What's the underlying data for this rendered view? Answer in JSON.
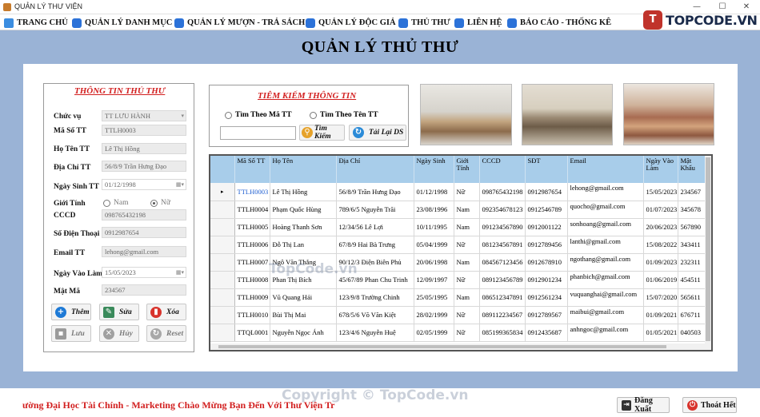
{
  "window": {
    "title": "QUẢN LÝ THƯ VIỆN",
    "minimize": "—",
    "maximize": "☐",
    "close": "✕"
  },
  "menu": [
    {
      "label": "TRANG CHỦ",
      "icon": "home-icon"
    },
    {
      "label": "QUẢN LÝ DANH MỤC",
      "icon": "folder-icon"
    },
    {
      "label": "QUẢN LÝ MƯỢN - TRẢ SÁCH",
      "icon": "book-icon"
    },
    {
      "label": "QUẢN LÝ ĐỘC GIẢ",
      "icon": "reader-icon"
    },
    {
      "label": "THỦ THƯ",
      "icon": "librarian-icon"
    },
    {
      "label": "LIÊN HỆ",
      "icon": "contact-icon"
    },
    {
      "label": "BÁO CÁO - THỐNG KÊ",
      "icon": "report-icon"
    }
  ],
  "logo": {
    "mark": "T",
    "text": "TOPCODE.VN"
  },
  "page_title": "QUẢN LÝ THỦ THƯ",
  "info_panel": {
    "title": "THÔNG TIN THỦ THƯ",
    "chuc_vu": {
      "label": "Chức vụ",
      "value": "TT LƯU HÀNH"
    },
    "ma_so": {
      "label": "Mã Số TT",
      "value": "TTLH0003"
    },
    "ho_ten": {
      "label": "Họ Tên TT",
      "value": "Lê Thị Hồng"
    },
    "dia_chi": {
      "label": "Địa Chỉ TT",
      "value": "56/8/9 Trần Hưng Đạo"
    },
    "ngay_sinh": {
      "label": "Ngày Sinh TT",
      "value": "01/12/1998"
    },
    "gioi_tinh": {
      "label": "Giới Tính",
      "options": [
        "Nam",
        "Nữ"
      ],
      "selected": "Nữ"
    },
    "cccd": {
      "label": "CCCD",
      "value": "098765432198"
    },
    "so_dien_thoai": {
      "label": "Số Điện Thoại",
      "value": "0912987654"
    },
    "email": {
      "label": "Email TT",
      "value": "lehong@gmail.com"
    },
    "ngay_vao_lam": {
      "label": "Ngày Vào Làm",
      "value": "15/05/2023"
    },
    "mat_ma": {
      "label": "Mật Mã",
      "value": "234567"
    },
    "buttons": {
      "them": "Thêm",
      "sua": "Sửa",
      "xoa": "Xóa",
      "luu": "Lưu",
      "huy": "Hủy",
      "reset": "Reset"
    }
  },
  "search_panel": {
    "title": "TIÊM KIẾM THÔNG TIN",
    "option_ma": "Tìm Theo Mã TT",
    "option_ten": "Tìm Theo Tên TT",
    "input_value": "",
    "search_button": "Tìm Kiếm",
    "reload_button": "Tải Lại DS"
  },
  "table": {
    "headers": [
      "Mã Số TT",
      "Họ Tên",
      "Địa Chỉ",
      "Ngày Sinh",
      "Giới Tính",
      "CCCD",
      "SĐT",
      "Email",
      "Ngày Vào Làm",
      "Mật Khẩu"
    ],
    "rows": [
      [
        "TTLH0003",
        "Lê Thị Hồng",
        "56/8/9 Trần Hưng Đạo",
        "01/12/1998",
        "Nữ",
        "098765432198",
        "0912987654",
        "lehong@gmail.com",
        "15/05/2023",
        "234567"
      ],
      [
        "TTLH0004",
        "Phạm Quốc Hùng",
        "789/6/5 Nguyễn Trãi",
        "23/08/1996",
        "Nam",
        "092354678123",
        "0912546789",
        "quocho@gmail.com",
        "01/07/2023",
        "345678"
      ],
      [
        "TTLH0005",
        "Hoàng Thanh Sơn",
        "12/34/56 Lê Lợi",
        "10/11/1995",
        "Nam",
        "091234567890",
        "0912001122",
        "sonhoang@gmail.com",
        "20/06/2023",
        "567890"
      ],
      [
        "TTLH0006",
        "Đỗ Thị Lan",
        "67/8/9 Hai Bà Trưng",
        "05/04/1999",
        "Nữ",
        "081234567891",
        "0912789456",
        "lanthi@gmail.com",
        "15/08/2022",
        "343411"
      ],
      [
        "TTLH0007",
        "Ngô Văn Thắng",
        "90/12/3 Điện Biên Phủ",
        "20/06/1998",
        "Nam",
        "084567123456",
        "0912678910",
        "ngothang@gmail.com",
        "01/09/2023",
        "232311"
      ],
      [
        "TTLH0008",
        "Phan Thị Bích",
        "45/67/89 Phan Chu Trinh",
        "12/09/1997",
        "Nữ",
        "089123456789",
        "0912901234",
        "phanbich@gmail.com",
        "01/06/2019",
        "454511"
      ],
      [
        "TTLH0009",
        "Vũ Quang Hải",
        "123/9/8 Trường Chinh",
        "25/05/1995",
        "Nam",
        "086512347891",
        "0912561234",
        "vuquanghai@gmail.com",
        "15/07/2020",
        "565611"
      ],
      [
        "TTLH0010",
        "Bùi Thị Mai",
        "678/5/6 Võ Văn Kiệt",
        "28/02/1999",
        "Nữ",
        "089112234567",
        "0912789567",
        "maibui@gmail.com",
        "01/09/2021",
        "676711"
      ],
      [
        "TTQL0001",
        "Nguyễn Ngọc Ánh",
        "123/4/6 Nguyễn Huệ",
        "02/05/1999",
        "Nữ",
        "085199365834",
        "0912435687",
        "anhngoc@gmail.com",
        "01/05/2021",
        "040503"
      ]
    ]
  },
  "footer": {
    "marquee": "ường Đại Học Tài Chính - Marketing Chào Mừng Bạn Đến Với Thư Viện Tr",
    "logout": "Đăng Xuất",
    "exit": "Thoát Hết"
  },
  "watermarks": [
    "TopCode.vn",
    "Copyright © TopCode.vn"
  ],
  "colors": {
    "accent_red": "#d21f1f",
    "header_blue": "#a8cdea",
    "background": "#9ab3d6"
  }
}
